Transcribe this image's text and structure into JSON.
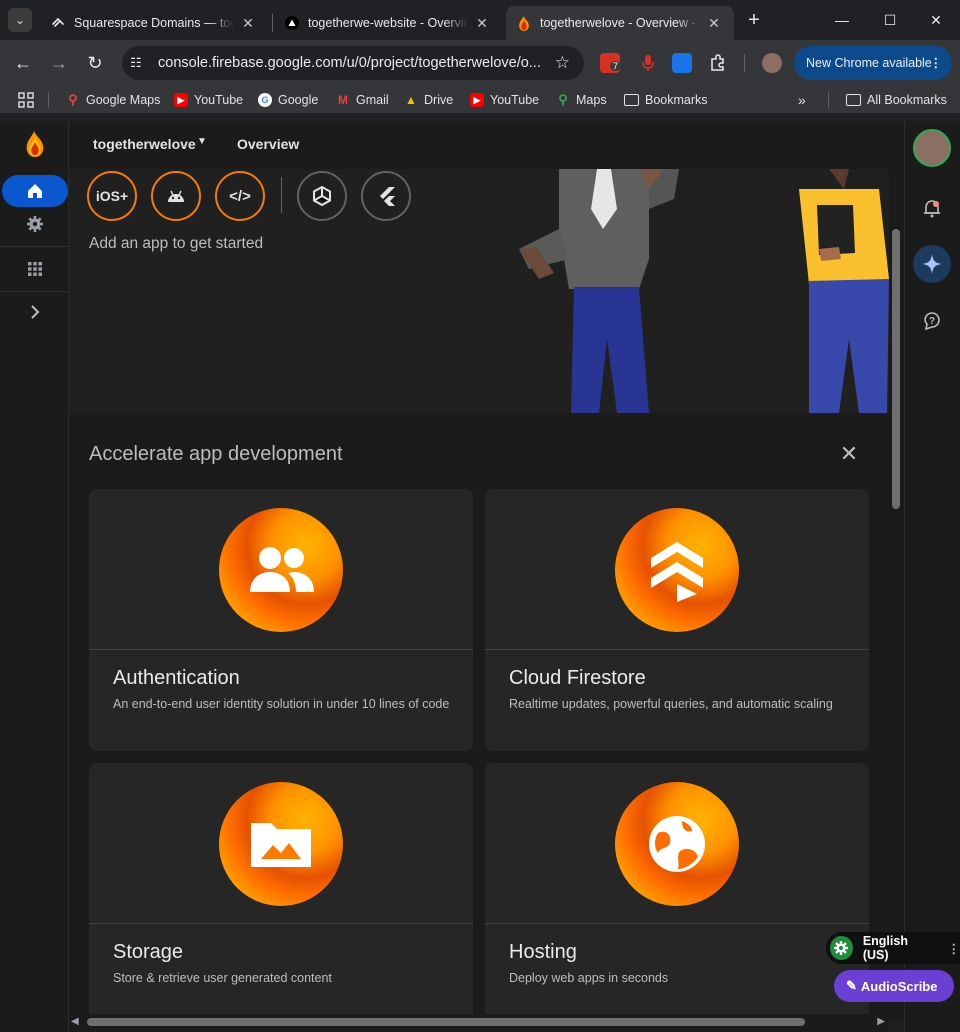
{
  "browser": {
    "tabs": [
      {
        "title": "Squarespace Domains — toge",
        "active": false
      },
      {
        "title": "togetherwe-website - Overview",
        "active": false
      },
      {
        "title": "togetherwelove - Overview - Fi",
        "active": true
      }
    ],
    "url": "console.firebase.google.com/u/0/project/togetherwelove/o...",
    "new_chrome_label": "New Chrome available",
    "ext_badge": "7",
    "bookmarks": [
      "Google Maps",
      "YouTube",
      "Google",
      "Gmail",
      "Drive",
      "YouTube",
      "Maps",
      "Bookmarks"
    ],
    "all_bookmarks": "All Bookmarks"
  },
  "console": {
    "project_name": "togetherwelove",
    "page_title": "Overview",
    "platforms": [
      {
        "name": "ios-platform",
        "label": "iOS+"
      },
      {
        "name": "android-platform",
        "label": ""
      },
      {
        "name": "web-platform",
        "label": "</>"
      },
      {
        "name": "unity-platform",
        "label": ""
      },
      {
        "name": "flutter-platform",
        "label": ""
      }
    ],
    "add_app_text": "Add an app to get started",
    "accelerate_title": "Accelerate app development",
    "cards": [
      {
        "title": "Authentication",
        "desc": "An end-to-end user identity solution in under 10 lines of code",
        "icon": "people-icon"
      },
      {
        "title": "Cloud Firestore",
        "desc": "Realtime updates, powerful queries, and automatic scaling",
        "icon": "firestore-icon"
      },
      {
        "title": "Storage",
        "desc": "Store & retrieve user generated content",
        "icon": "folder-image-icon"
      },
      {
        "title": "Hosting",
        "desc": "Deploy web apps in seconds",
        "icon": "globe-icon"
      }
    ]
  },
  "overlays": {
    "language": "English (US)",
    "audioscribe": "AudioScribe"
  },
  "colors": {
    "accent_orange": "#f57c00",
    "nav_active": "#0b57d0",
    "chrome_bg": "#202124",
    "toolbar_bg": "#35363a"
  }
}
